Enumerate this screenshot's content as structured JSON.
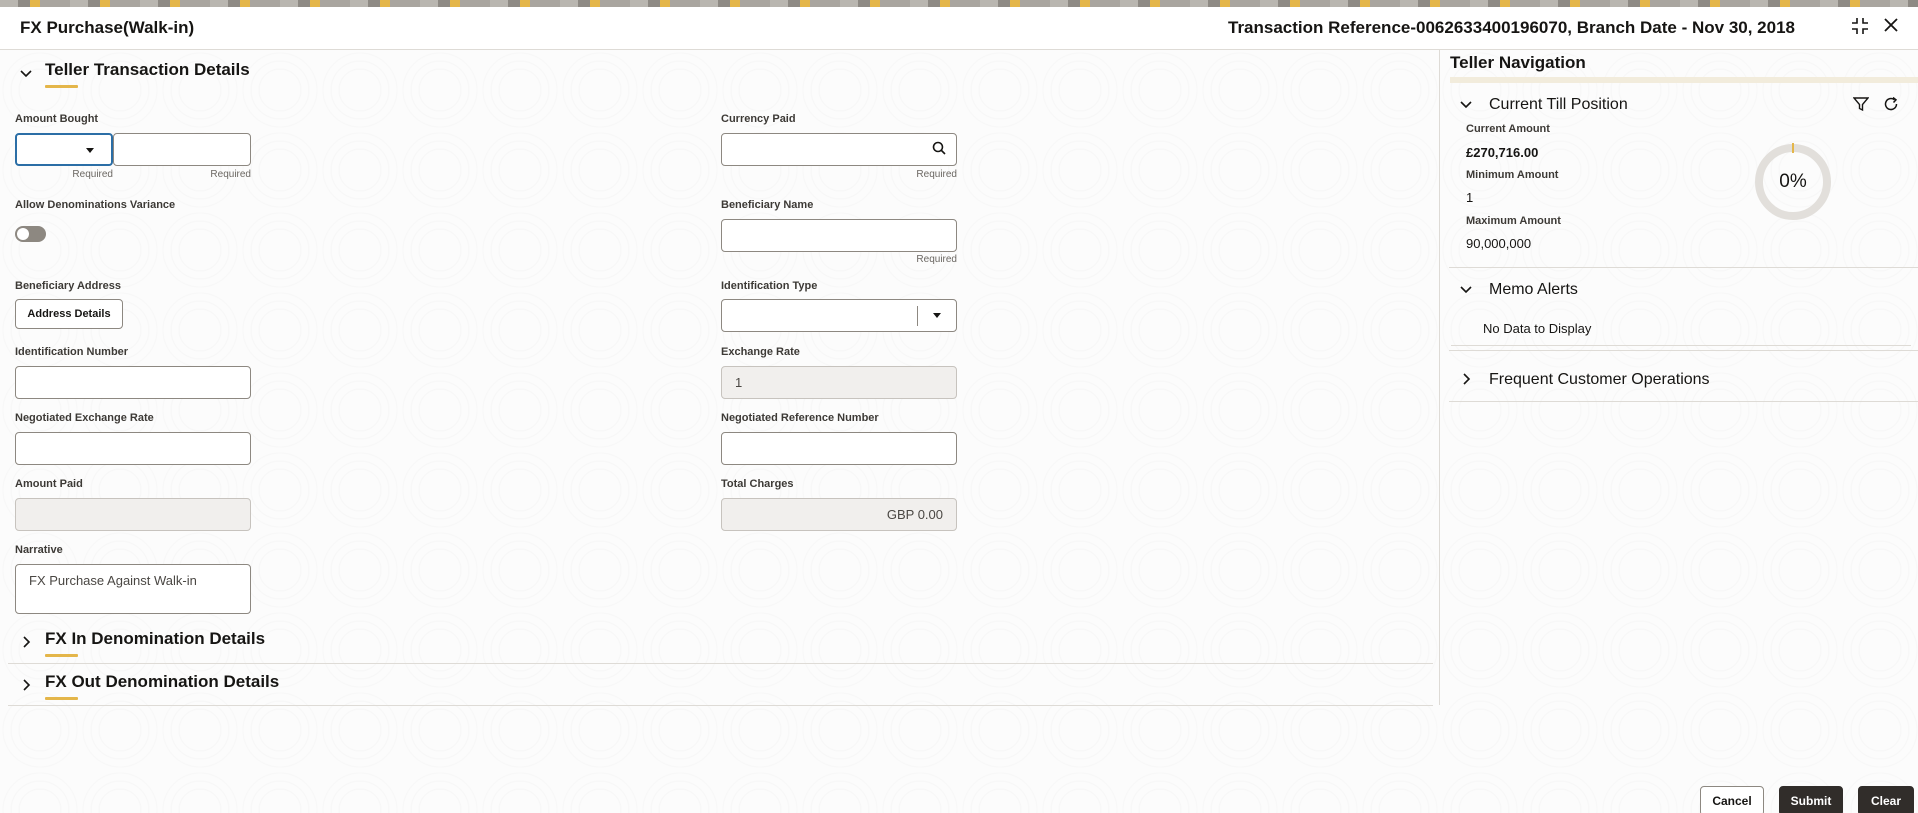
{
  "header": {
    "title": "FX Purchase(Walk-in)",
    "reference": "Transaction Reference-0062633400196070, Branch Date - Nov 30, 2018",
    "icons": [
      "collapse-icon",
      "close-icon"
    ]
  },
  "sections": {
    "teller_details": "Teller Transaction Details",
    "fx_in": "FX In Denomination Details",
    "fx_out": "FX Out Denomination Details"
  },
  "form": {
    "amount_bought": {
      "label": "Amount Bought",
      "currency_value": "",
      "amount_value": "",
      "required": "Required"
    },
    "currency_paid": {
      "label": "Currency Paid",
      "value": "",
      "required": "Required"
    },
    "allow_variance": {
      "label": "Allow Denominations Variance",
      "on": false
    },
    "beneficiary_name": {
      "label": "Beneficiary Name",
      "value": "",
      "required": "Required"
    },
    "beneficiary_address": {
      "label": "Beneficiary Address",
      "button": "Address Details"
    },
    "identification_type": {
      "label": "Identification Type",
      "value": ""
    },
    "identification_number": {
      "label": "Identification Number",
      "value": ""
    },
    "exchange_rate": {
      "label": "Exchange Rate",
      "value": "1"
    },
    "negotiated_exchange_rate": {
      "label": "Negotiated Exchange Rate",
      "value": ""
    },
    "negotiated_reference_number": {
      "label": "Negotiated Reference Number",
      "value": ""
    },
    "amount_paid": {
      "label": "Amount Paid",
      "value": ""
    },
    "total_charges": {
      "label": "Total Charges",
      "value": "GBP 0.00"
    },
    "narrative": {
      "label": "Narrative",
      "value": "FX Purchase Against Walk-in"
    }
  },
  "side": {
    "title": "Teller Navigation",
    "till": {
      "title": "Current Till Position",
      "current_label": "Current Amount",
      "current_value": "£270,716.00",
      "min_label": "Minimum Amount",
      "min_value": "1",
      "max_label": "Maximum Amount",
      "max_value": "90,000,000",
      "percent_text": "0%",
      "percent": 0
    },
    "memo": {
      "title": "Memo Alerts",
      "empty": "No Data to Display"
    },
    "frequent": {
      "title": "Frequent Customer Operations"
    }
  },
  "footer": {
    "cancel": "Cancel",
    "submit": "Submit",
    "clear": "Clear"
  },
  "colors": {
    "accent": "#e4b64a",
    "dark_button": "#312d2a",
    "border": "#8d8881"
  }
}
